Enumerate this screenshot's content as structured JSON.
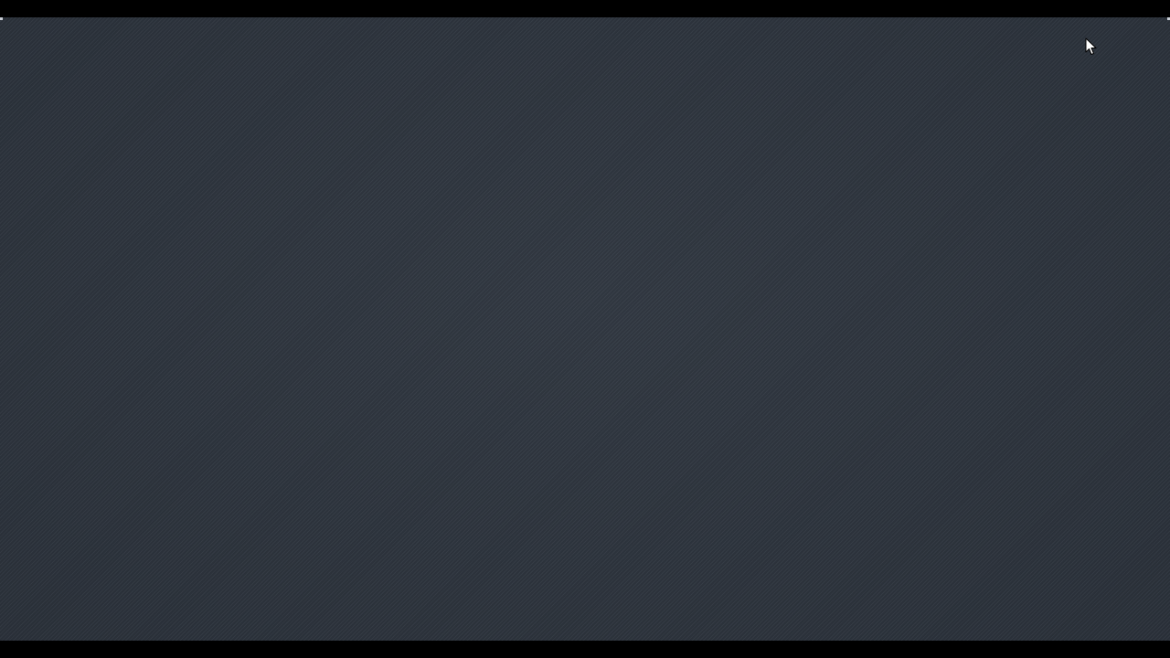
{
  "screen": {
    "background_color": "#2f3640",
    "letterbox_color": "#000000"
  },
  "desktop": {
    "pattern": "diagonal-stripes",
    "icons": []
  },
  "cursor": {
    "icon": "arrow-pointer-icon",
    "fill": "#ffffff",
    "stroke": "#000000"
  }
}
